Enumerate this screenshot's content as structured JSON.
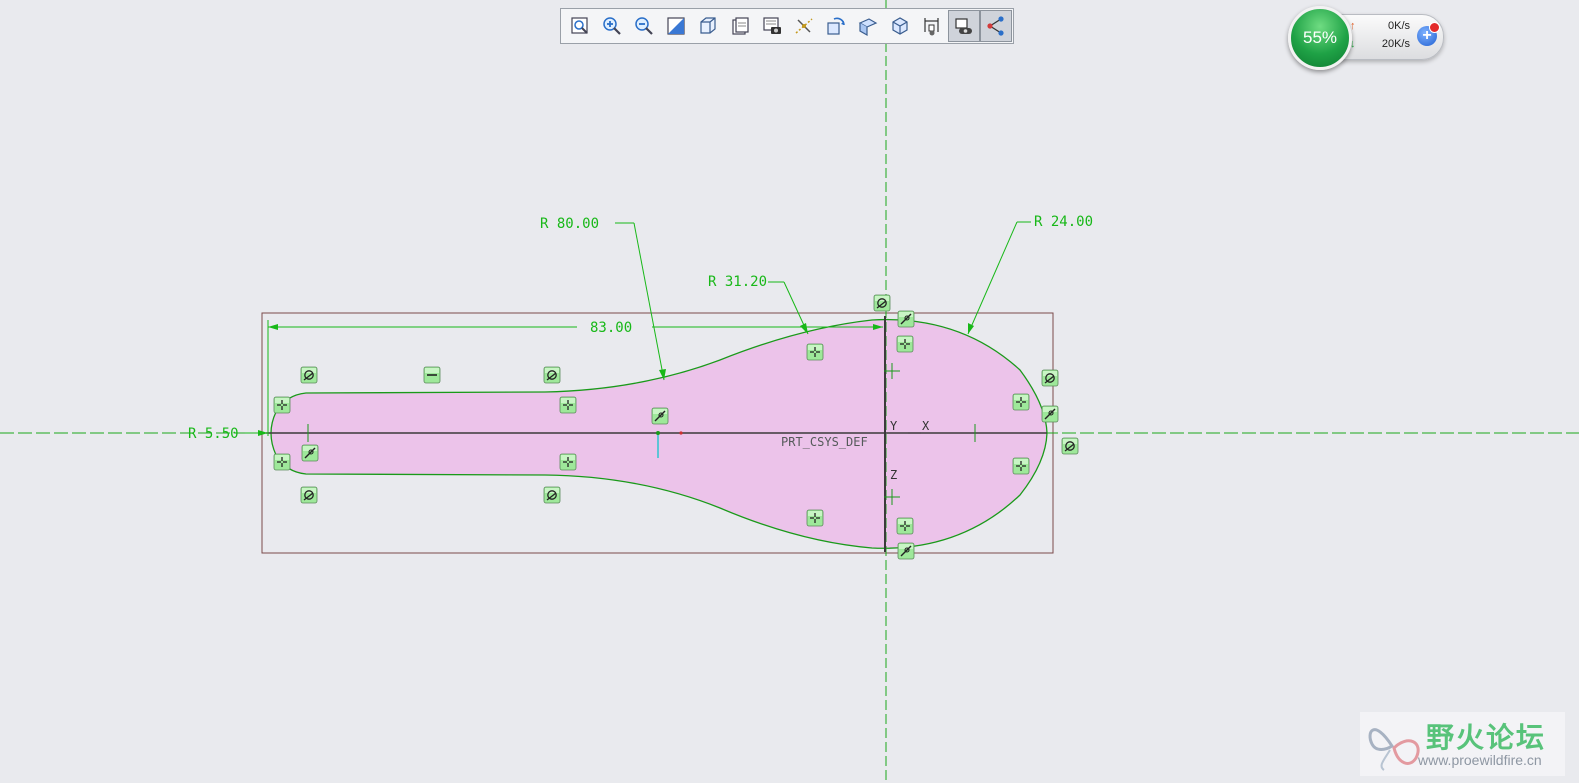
{
  "toolbar": {
    "buttons": [
      {
        "name": "refit-button",
        "icon": "refit-icon"
      },
      {
        "name": "zoom-in-button",
        "icon": "zoom-in-icon"
      },
      {
        "name": "zoom-out-button",
        "icon": "zoom-out-icon"
      },
      {
        "name": "repaint-button",
        "icon": "repaint-icon"
      },
      {
        "name": "display-style-button",
        "icon": "cube-icon"
      },
      {
        "name": "saved-orientations-button",
        "icon": "saved-views-icon"
      },
      {
        "name": "view-manager-button",
        "icon": "view-manager-icon"
      },
      {
        "name": "datum-display-filters-button",
        "icon": "datum-filters-icon"
      },
      {
        "name": "spin-center-button",
        "icon": "spin-center-icon"
      },
      {
        "name": "sketch-view-button",
        "icon": "sketch-view-icon"
      },
      {
        "name": "view-orient-button",
        "icon": "orient-cube-icon"
      },
      {
        "name": "sketcher-display-filters-button",
        "icon": "dimension-display-icon"
      },
      {
        "name": "constraints-display-button",
        "icon": "constraints-display-icon",
        "active": true
      },
      {
        "name": "vertex-display-button",
        "icon": "vertex-display-icon",
        "active": true
      }
    ]
  },
  "sketch": {
    "dimensions": {
      "r80": "R 80.00",
      "r31": "R 31.20",
      "r24": "R 24.00",
      "len83": "83.00",
      "r5": "R 5.50"
    },
    "csys_label": "PRT_CSYS_DEF",
    "axis_y": "Y",
    "axis_x": "X",
    "axis_z": "Z",
    "colors": {
      "background": "#e9eaee",
      "fill": "#ecc3ea",
      "geometry": "#1a9a1a",
      "dimension": "#18b818",
      "centerline": "#1aa81a",
      "bbox": "#7a4a4a"
    }
  },
  "network": {
    "percent": "55%",
    "upload": "0K/s",
    "download": "20K/s",
    "up_arrow": "↑",
    "down_arrow": "↓",
    "plus": "+"
  },
  "watermark": {
    "title": "野火论坛",
    "url": "www.proewildfire.cn"
  }
}
